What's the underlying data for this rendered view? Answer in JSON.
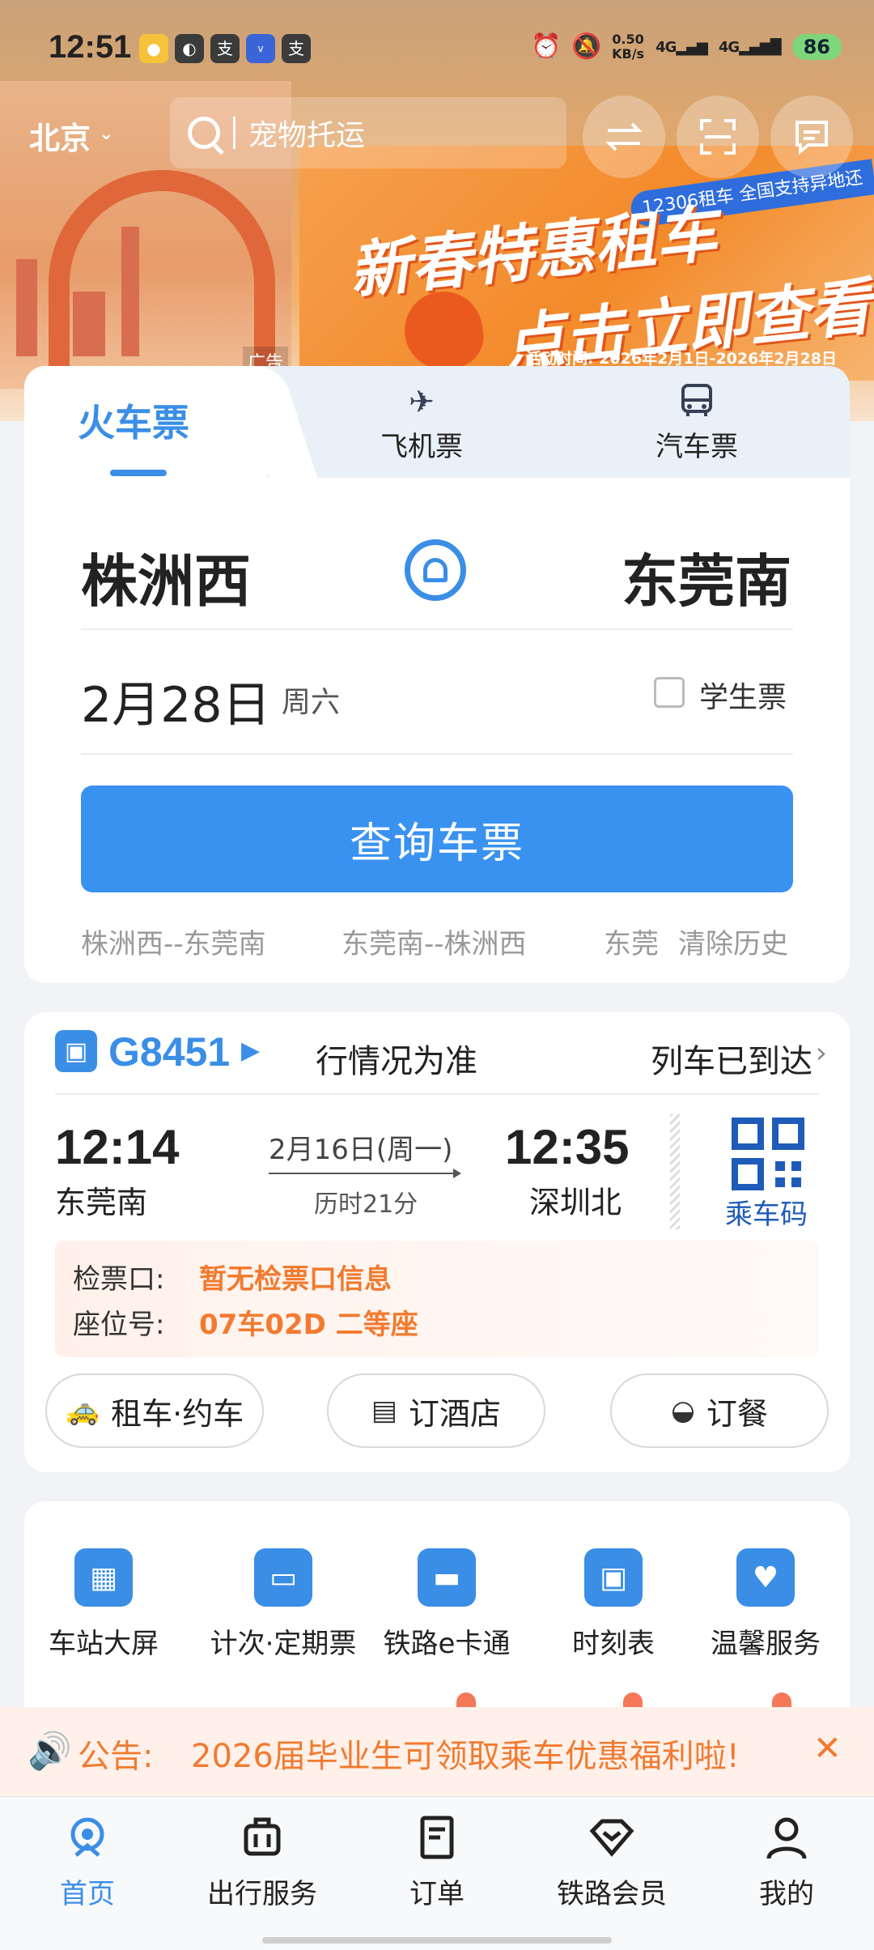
{
  "statusbar": {
    "time": "12:51",
    "net_speed": "0.50",
    "net_unit": "KB/s",
    "sig1": "4G",
    "sig2": "4G",
    "battery": "86"
  },
  "header": {
    "city": "北京",
    "search_placeholder": "宠物托运"
  },
  "banner": {
    "rental_tag": "12306租车 全国支持异地还",
    "line1": "新春特惠租车",
    "line2": "点击立即查看",
    "event_time": "活动时间: 2026年2月1日-2026年2月28日",
    "ad_label": "广告"
  },
  "ticket_tabs": {
    "train": "火车票",
    "flight": "飞机票",
    "bus": "汽车票"
  },
  "search_form": {
    "from_station": "株洲西",
    "to_station": "东莞南",
    "date": "2月28日",
    "weekday": "周六",
    "student_label": "学生票",
    "query_button": "查询车票",
    "history": [
      "株洲西--东莞南",
      "东莞南--株洲西",
      "东莞"
    ],
    "clear_history": "清除历史"
  },
  "trip": {
    "train_no": "G8451",
    "notice": "行情况为准",
    "status": "列车已到达",
    "dep_time": "12:14",
    "dep_station": "东莞南",
    "date": "2月16日(周一)",
    "duration": "历时21分",
    "arr_time": "12:35",
    "arr_station": "深圳北",
    "qr_label": "乘车码",
    "gate_label": "检票口:",
    "gate_value": "暂无检票口信息",
    "seat_label": "座位号:",
    "seat_value": "07车02D 二等座",
    "actions": [
      "租车·约车",
      "订酒店",
      "订餐"
    ]
  },
  "services": [
    {
      "label": "车站大屏"
    },
    {
      "label": "计次·定期票"
    },
    {
      "label": "铁路e卡通"
    },
    {
      "label": "时刻表"
    },
    {
      "label": "温馨服务"
    }
  ],
  "announcement": {
    "label": "公告:",
    "text": "2026届毕业生可领取乘车优惠福利啦!"
  },
  "bottom_nav": [
    {
      "label": "首页",
      "icon": "home-icon"
    },
    {
      "label": "出行服务",
      "icon": "luggage-icon"
    },
    {
      "label": "订单",
      "icon": "order-icon"
    },
    {
      "label": "铁路会员",
      "icon": "diamond-icon"
    },
    {
      "label": "我的",
      "icon": "user-icon"
    }
  ],
  "colors": {
    "primary": "#3a8ee6",
    "accent_orange": "#f27a30",
    "qr_blue": "#1f5bb8"
  }
}
